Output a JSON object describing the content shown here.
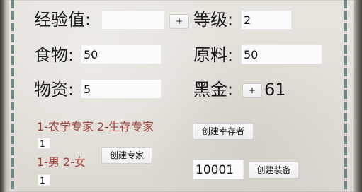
{
  "fields": {
    "exp": {
      "label": "经验值:",
      "value": "",
      "plus": "+"
    },
    "level": {
      "label": "等级:",
      "value": "2"
    },
    "food": {
      "label": "食物:",
      "value": "50"
    },
    "raw": {
      "label": "原料:",
      "value": "50"
    },
    "supplies": {
      "label": "物资:",
      "value": "5"
    },
    "blackgold": {
      "label": "黑金:",
      "plus": "+",
      "value": "61"
    }
  },
  "expert": {
    "type_hint": "1-农学专家 2-生存专家",
    "type_value": "1",
    "gender_hint": "1-男 2-女",
    "gender_value": "1",
    "create_expert_button": "创建专家"
  },
  "survivor": {
    "create_survivor_button": "创建幸存者"
  },
  "equipment": {
    "id_value": "10001",
    "create_equipment_button": "创建装备"
  },
  "colors": {
    "hint_red": "#a1453f",
    "frame_teal": "#4c6b6e"
  }
}
